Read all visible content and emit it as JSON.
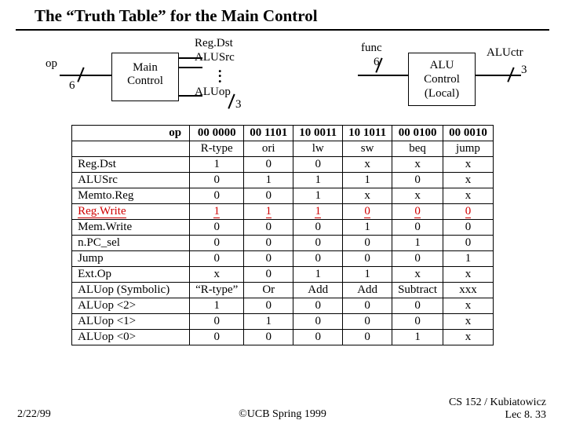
{
  "title": "The “Truth Table” for the Main Control",
  "diagram": {
    "op_label": "op",
    "op_width": "6",
    "main_box_l1": "Main",
    "main_box_l2": "Control",
    "regdst": "Reg.Dst",
    "alusrc": "ALUSrc",
    "aluop": "ALUop",
    "aluop_width": "3",
    "func_label": "func",
    "func_width": "6",
    "alu_box_l1": "ALU",
    "alu_box_l2": "Control",
    "alu_box_l3": "(Local)",
    "aluctr": "ALUctr",
    "aluctr_width": "3"
  },
  "table": {
    "head": [
      "op",
      "00 0000",
      "00 1101",
      "10 0011",
      "10 1011",
      "00 0100",
      "00 0010"
    ],
    "type_row": [
      "",
      "R-type",
      "ori",
      "lw",
      "sw",
      "beq",
      "jump"
    ],
    "rows": [
      {
        "label": "Reg.Dst",
        "v": [
          "1",
          "0",
          "0",
          "x",
          "x",
          "x"
        ]
      },
      {
        "label": "ALUSrc",
        "v": [
          "0",
          "1",
          "1",
          "1",
          "0",
          "x"
        ]
      },
      {
        "label": "Memto.Reg",
        "v": [
          "0",
          "0",
          "1",
          "x",
          "x",
          "x"
        ]
      },
      {
        "label": "Reg.Write",
        "v": [
          "1",
          "1",
          "1",
          "0",
          "0",
          "0"
        ],
        "red": true
      },
      {
        "label": "Mem.Write",
        "v": [
          "0",
          "0",
          "0",
          "1",
          "0",
          "0"
        ]
      },
      {
        "label": "n.PC_sel",
        "v": [
          "0",
          "0",
          "0",
          "0",
          "1",
          "0"
        ]
      },
      {
        "label": "Jump",
        "v": [
          "0",
          "0",
          "0",
          "0",
          "0",
          "1"
        ]
      },
      {
        "label": "Ext.Op",
        "v": [
          "x",
          "0",
          "1",
          "1",
          "x",
          "x"
        ]
      },
      {
        "label": "ALUop (Symbolic)",
        "v": [
          "“R-type”",
          "Or",
          "Add",
          "Add",
          "Subtract",
          "xxx"
        ]
      },
      {
        "label": "ALUop <2>",
        "v": [
          "1",
          "0",
          "0",
          "0",
          "0",
          "x"
        ]
      },
      {
        "label": "ALUop <1>",
        "v": [
          "0",
          "1",
          "0",
          "0",
          "0",
          "x"
        ]
      },
      {
        "label": "ALUop <0>",
        "v": [
          "0",
          "0",
          "0",
          "0",
          "1",
          "x"
        ]
      }
    ]
  },
  "footer": {
    "date": "2/22/99",
    "copy": "©UCB Spring 1999",
    "src_l1": "CS 152 / Kubiatowicz",
    "src_l2": "Lec 8. 33"
  }
}
